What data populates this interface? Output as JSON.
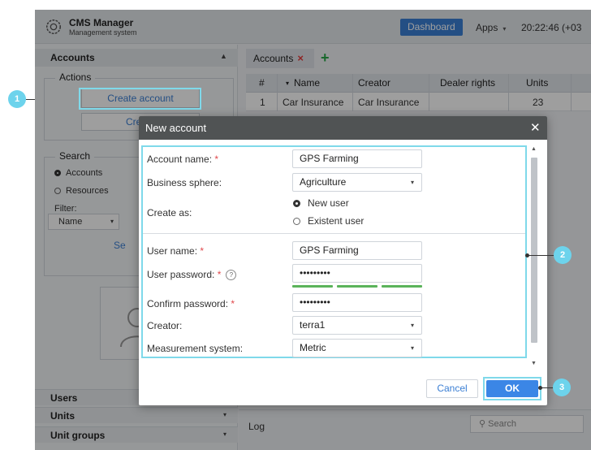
{
  "header": {
    "app_title": "CMS Manager",
    "app_subtitle": "Management system",
    "dashboard_label": "Dashboard",
    "apps_label": "Apps",
    "clock": "20:22:46 (+03"
  },
  "sidebar": {
    "accounts_label": "Accounts",
    "actions_legend": "Actions",
    "create_account_label": "Create account",
    "create_other_label": "Create",
    "search_legend": "Search",
    "search_accounts_label": "Accounts",
    "search_resources_label": "Resources",
    "filter_label": "Filter:",
    "filter_value": "Name",
    "search_button": "Se",
    "bottom_items": [
      "Users",
      "Units",
      "Unit groups"
    ]
  },
  "tabs": {
    "accounts_tab": "Accounts"
  },
  "grid": {
    "columns": [
      "#",
      "Name",
      "Creator",
      "Dealer rights",
      "Units"
    ],
    "rows": [
      {
        "num": "1",
        "name": "Car Insurance",
        "creator": "Car Insurance",
        "dealer_rights": "",
        "units": "23"
      }
    ]
  },
  "log": {
    "label": "Log",
    "search_placeholder": "Search"
  },
  "dialog": {
    "title": "New account",
    "account_name_label": "Account name:",
    "account_name_value": "GPS Farming",
    "business_sphere_label": "Business sphere:",
    "business_sphere_value": "Agriculture",
    "create_as_label": "Create as:",
    "create_as_new": "New user",
    "create_as_existent": "Existent user",
    "user_name_label": "User name:",
    "user_name_value": "GPS Farming",
    "user_password_label": "User password:",
    "user_password_value": "•••••••••",
    "help_mark": "?",
    "confirm_password_label": "Confirm password:",
    "confirm_password_value": "•••••••••",
    "creator_label": "Creator:",
    "creator_value": "terra1",
    "measurement_label": "Measurement system:",
    "measurement_value": "Metric",
    "required_mark": "*",
    "cancel_label": "Cancel",
    "ok_label": "OK",
    "password_strength_segments": 3
  },
  "callouts": [
    "1",
    "2",
    "3"
  ],
  "colors": {
    "accent": "#3b80d6",
    "highlight": "#7fd9ea",
    "callout": "#6dd3ec",
    "required": "#e0484c",
    "strength": "#5ab35a",
    "dialog_header": "#505354"
  }
}
